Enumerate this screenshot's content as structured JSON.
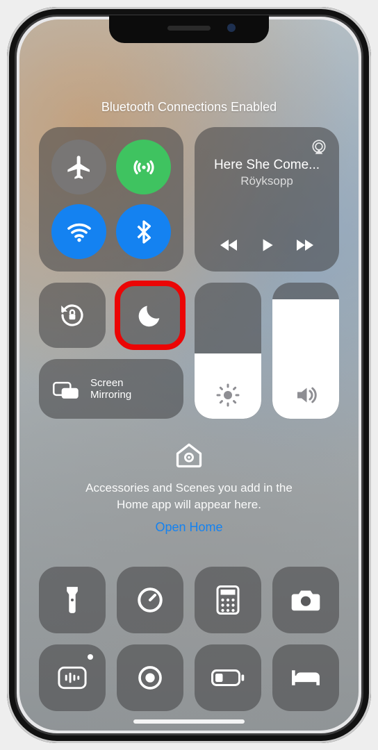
{
  "banner": "Bluetooth Connections Enabled",
  "media": {
    "track": "Here She Come...",
    "artist": "Röyksopp"
  },
  "screenMirroring": {
    "label": "Screen\nMirroring"
  },
  "home": {
    "text1": "Accessories and Scenes you add in the",
    "text2": "Home app will appear here.",
    "link": "Open Home"
  },
  "sliders": {
    "brightness": 48,
    "volume": 88
  }
}
